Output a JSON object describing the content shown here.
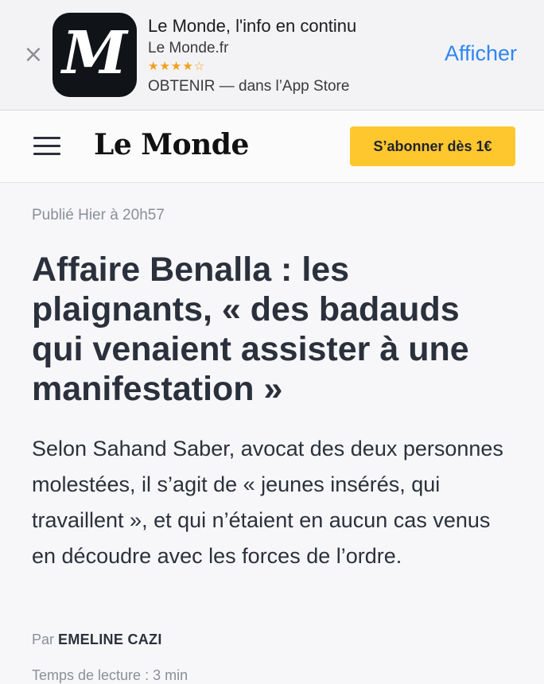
{
  "banner": {
    "close_icon": "close-icon",
    "app_icon_letter": "M",
    "title": "Le Monde, l'info en continu",
    "subtitle": "Le Monde.fr",
    "stars": "★★★★☆",
    "store": "OBTENIR — dans l’App Store",
    "view_label": "Afficher"
  },
  "header": {
    "menu_icon": "hamburger-menu-icon",
    "logo": "Le Monde",
    "subscribe_label": "S’abonner dès 1€"
  },
  "article": {
    "published": "Publié Hier à 20h57",
    "headline": "Affaire Benalla : les plaignants, « des badauds qui venaient assister à une manifestation »",
    "lede": "Selon Sahand Saber, avocat des deux personnes molestées, il s’agit de « jeunes insérés, qui travaillent », et qui n’étaient en aucun cas venus en découdre avec les forces de l’ordre.",
    "byline_prefix": "Par",
    "author": "EMELINE CAZI",
    "reading_time": "Temps de lecture : 3 min"
  },
  "colors": {
    "accent_button": "#ffc72e",
    "link_blue": "#2f86f6",
    "text_dark": "#2b313c",
    "text_muted": "#8a8f98"
  }
}
